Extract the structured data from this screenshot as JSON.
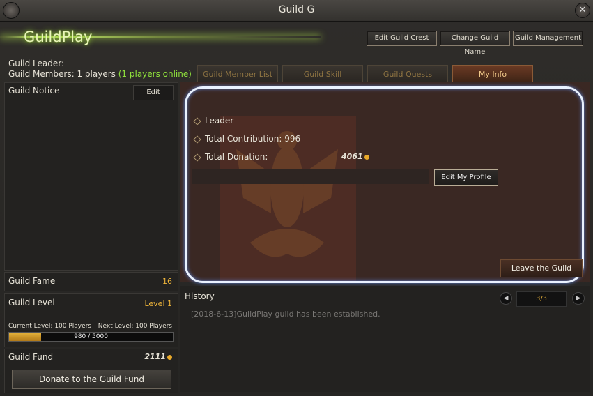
{
  "window": {
    "title": "Guild G",
    "close_icon": "close-icon"
  },
  "header": {
    "guild_name": "GuildPlay",
    "buttons": [
      "Edit Guild Crest",
      "Change Guild Name",
      "Guild Management"
    ]
  },
  "info": {
    "leader_label": "Guild Leader:",
    "members_label": "Guild Members: 1 players",
    "online_text": "(1 players online)"
  },
  "tabs": [
    {
      "label": "Guild Member List",
      "active": false
    },
    {
      "label": "Guild Skill",
      "active": false
    },
    {
      "label": "Guild Quests",
      "active": false
    },
    {
      "label": "My Info",
      "active": true
    }
  ],
  "notice": {
    "label": "Guild Notice",
    "edit_button": "Edit"
  },
  "fame": {
    "label": "Guild Fame",
    "value": "16"
  },
  "level": {
    "label": "Guild Level",
    "value": "Level 1",
    "current": "Current Level: 100 Players",
    "next": "Next Level: 100 Players",
    "progress_text": "980 / 5000",
    "progress_fraction": 0.196
  },
  "fund": {
    "label": "Guild Fund",
    "value": "2111",
    "donate_button": "Donate to the Guild Fund"
  },
  "myinfo": {
    "role": "Leader",
    "contribution": "Total Contribution: 996",
    "donation_label": "Total Donation:",
    "donation_value": "4061",
    "edit_profile_button": "Edit My Profile",
    "leave_button": "Leave the Guild"
  },
  "history": {
    "label": "History",
    "page": "3/3",
    "entries": [
      "[2018-6-13]GuildPlay guild has been established."
    ]
  },
  "colors": {
    "accent_gold": "#f0b63a",
    "online_green": "#8fe03c",
    "highlight": "#e9f1ff"
  }
}
